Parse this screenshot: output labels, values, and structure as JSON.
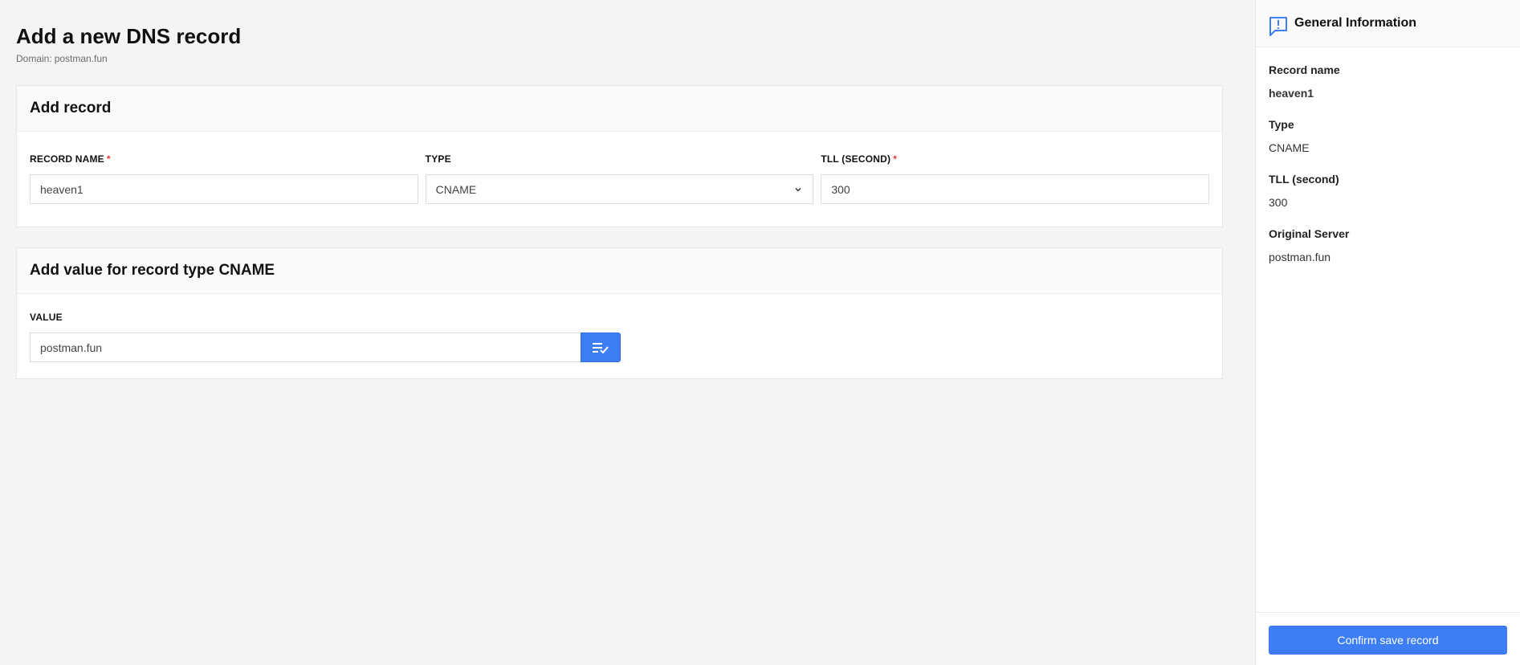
{
  "page": {
    "title": "Add a new DNS record",
    "domain_label": "Domain:",
    "domain_value": "postman.fun"
  },
  "add_record": {
    "title": "Add record",
    "record_name_label": "RECORD NAME",
    "record_name_value": "heaven1",
    "type_label": "TYPE",
    "type_value": "CNAME",
    "ttl_label": "TLL (SECOND)",
    "ttl_value": "300",
    "required_mark": "*"
  },
  "add_value": {
    "title": "Add value for record type CNAME",
    "value_label": "VALUE",
    "value": "postman.fun",
    "action_icon": "list-check-icon"
  },
  "sidebar": {
    "title": "General Information",
    "icon": "alert-message-icon",
    "items": [
      {
        "label": "Record name",
        "value": "heaven1"
      },
      {
        "label": "Type",
        "value": "CNAME"
      },
      {
        "label": "TLL (second)",
        "value": "300"
      },
      {
        "label": "Original Server",
        "value": "postman.fun"
      }
    ],
    "confirm_label": "Confirm save record"
  },
  "colors": {
    "accent": "#3d7ef6",
    "required": "#e53935",
    "background": "#f4f4f4"
  }
}
